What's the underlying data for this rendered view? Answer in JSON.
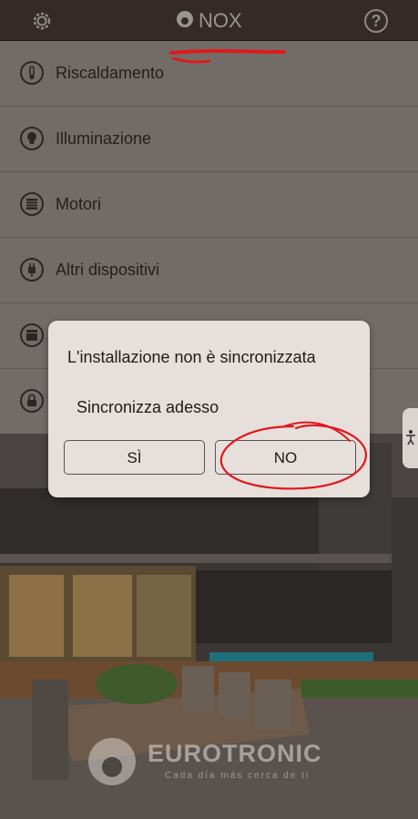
{
  "app": {
    "title": "NOX",
    "icons": {
      "settings": "gear-icon",
      "help": "help-icon",
      "logo": "nox-logo-icon"
    }
  },
  "menu": {
    "items": [
      {
        "label": "Riscaldamento",
        "icon": "thermometer-icon"
      },
      {
        "label": "Illuminazione",
        "icon": "lightbulb-icon"
      },
      {
        "label": "Motori",
        "icon": "shutter-icon"
      },
      {
        "label": "Altri dispositivi",
        "icon": "plug-icon"
      },
      {
        "label": "",
        "icon": "clapperboard-icon"
      },
      {
        "label": "",
        "icon": "lock-icon"
      }
    ]
  },
  "dialog": {
    "title": "L'installazione non è sincronizzata",
    "message": "Sincronizza adesso",
    "yes_label": "SÌ",
    "no_label": "NO"
  },
  "branding": {
    "name": "EUROTRONIC",
    "tagline": "Cada día más cerca de ti"
  },
  "accessibility": {
    "icon": "accessibility-icon"
  },
  "colors": {
    "topbar": "#342b26",
    "menu_bg": "#726c69",
    "dialog_bg": "#e6dfdb",
    "annotation": "#e0191c"
  }
}
